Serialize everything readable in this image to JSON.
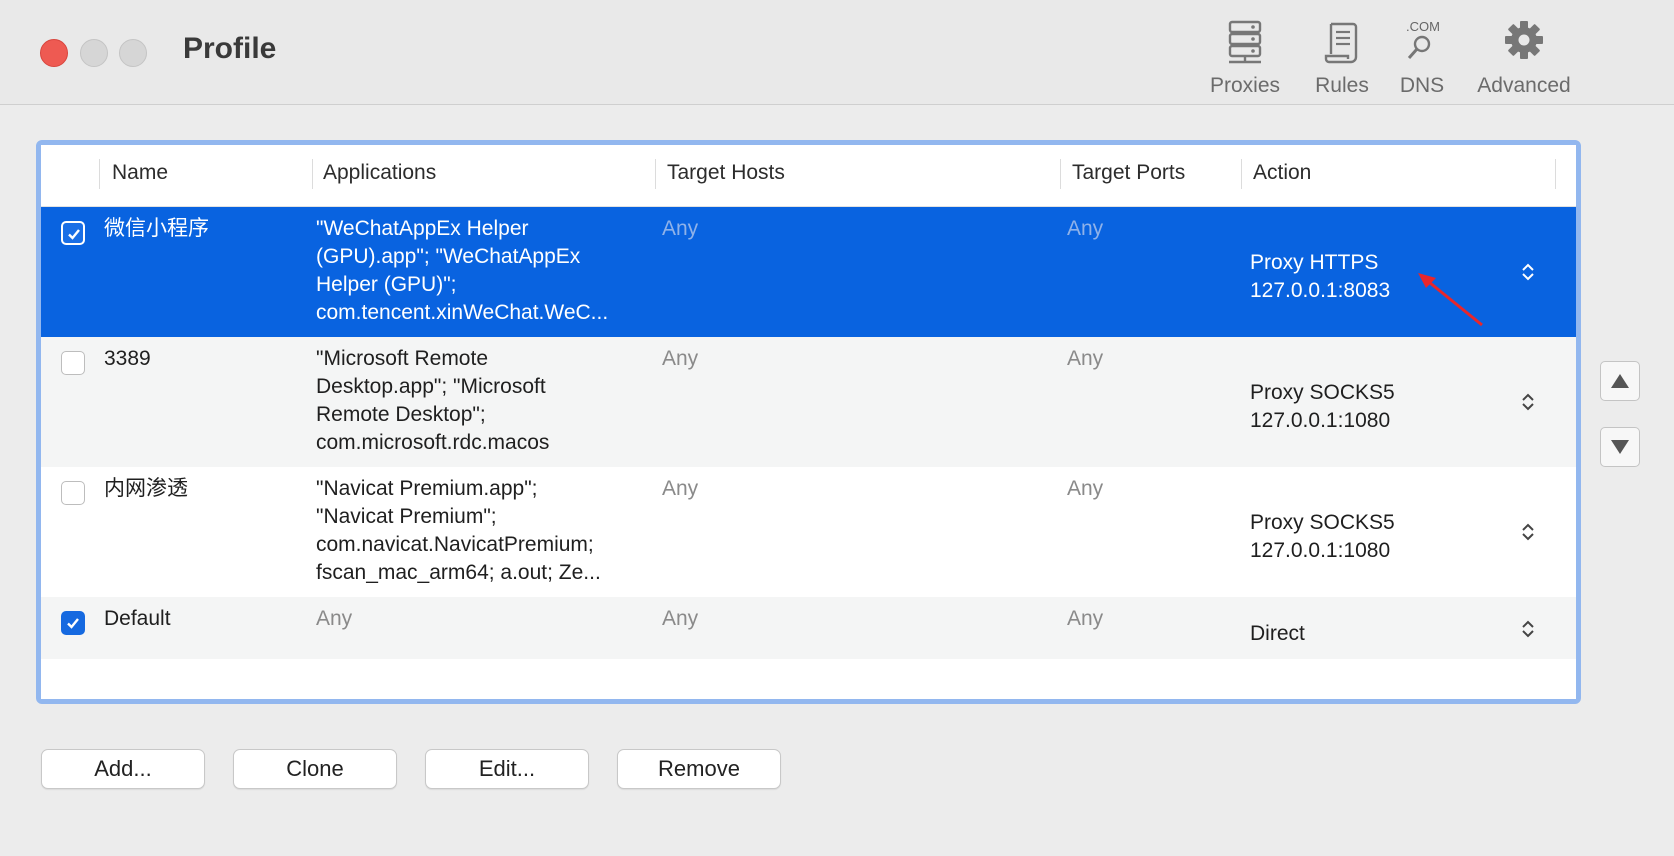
{
  "window": {
    "title": "Profile"
  },
  "toolbar": {
    "proxies": "Proxies",
    "rules": "Rules",
    "dns": "DNS",
    "dns_badge": ".COM",
    "advanced": "Advanced"
  },
  "table": {
    "columns": [
      "Name",
      "Applications",
      "Target Hosts",
      "Target Ports",
      "Action"
    ],
    "rows": [
      {
        "enabled": true,
        "name": "微信小程序",
        "applications": [
          "\"WeChatAppEx Helper",
          "(GPU).app\"; \"WeChatAppEx",
          "Helper (GPU)\";",
          "com.tencent.xinWeChat.WeC..."
        ],
        "target_hosts": "Any",
        "target_ports": "Any",
        "action": [
          "Proxy HTTPS",
          "127.0.0.1:8083"
        ]
      },
      {
        "enabled": false,
        "name": "3389",
        "applications": [
          "\"Microsoft Remote",
          "Desktop.app\"; \"Microsoft",
          "Remote Desktop\";",
          "com.microsoft.rdc.macos"
        ],
        "target_hosts": "Any",
        "target_ports": "Any",
        "action": [
          "Proxy SOCKS5",
          "127.0.0.1:1080"
        ]
      },
      {
        "enabled": false,
        "name": "内网渗透",
        "applications": [
          "\"Navicat Premium.app\";",
          "\"Navicat Premium\";",
          "com.navicat.NavicatPremium;",
          "fscan_mac_arm64; a.out; Ze..."
        ],
        "target_hosts": "Any",
        "target_ports": "Any",
        "action": [
          "Proxy SOCKS5",
          "127.0.0.1:1080"
        ]
      },
      {
        "enabled": true,
        "name": "Default",
        "applications": [
          "Any"
        ],
        "target_hosts": "Any",
        "target_ports": "Any",
        "action": [
          "Direct"
        ]
      }
    ]
  },
  "buttons": {
    "add": "Add...",
    "clone": "Clone",
    "edit": "Edit...",
    "remove": "Remove"
  },
  "colors": {
    "selection": "#0963e0",
    "accent_border": "#92b7ef",
    "close_button": "#ee5a52",
    "annotation_arrow": "#e8262b"
  }
}
